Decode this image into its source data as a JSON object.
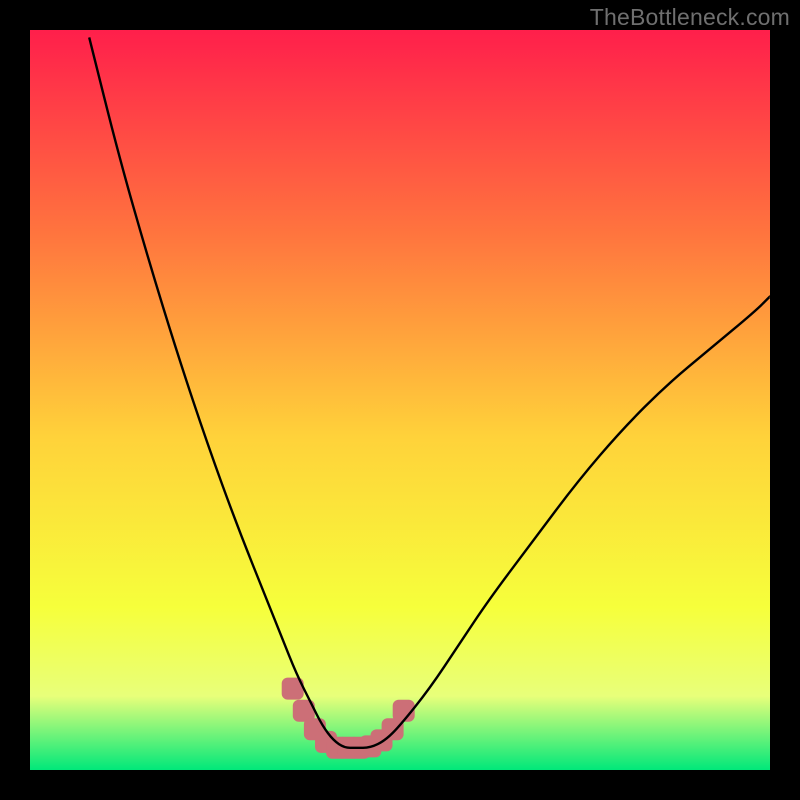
{
  "watermark": "TheBottleneck.com",
  "colors": {
    "gradient_top": "#ff1f4b",
    "gradient_upper_mid": "#ff763e",
    "gradient_mid": "#ffd23a",
    "gradient_lower_mid": "#f6ff3b",
    "gradient_green_band": "#e8ff7a",
    "gradient_bottom": "#00e87a",
    "curve": "#000000",
    "marker": "#cc6f77",
    "background": "#000000"
  },
  "chart_data": {
    "type": "line",
    "title": "",
    "xlabel": "",
    "ylabel": "",
    "xlim": [
      0,
      100
    ],
    "ylim": [
      0,
      100
    ],
    "series": [
      {
        "name": "bottleneck-curve",
        "x": [
          8,
          12,
          16,
          20,
          24,
          28,
          32,
          34,
          36,
          38,
          39.5,
          41,
          42.5,
          44,
          46,
          48,
          50,
          54,
          58,
          62,
          68,
          74,
          80,
          86,
          92,
          98,
          100
        ],
        "y": [
          99,
          83,
          69,
          56,
          44,
          33,
          23,
          18,
          13,
          9,
          6,
          4,
          3,
          3,
          3,
          4,
          6,
          11,
          17,
          23,
          31,
          39,
          46,
          52,
          57,
          62,
          64
        ]
      }
    ],
    "markers": {
      "name": "highlighted-minimum",
      "x": [
        35.5,
        37,
        38.5,
        40,
        41.5,
        43,
        44.5,
        46,
        47.5,
        49,
        50.5
      ],
      "y": [
        11,
        8,
        5.5,
        3.8,
        3,
        3,
        3,
        3.2,
        4,
        5.5,
        8
      ]
    }
  }
}
